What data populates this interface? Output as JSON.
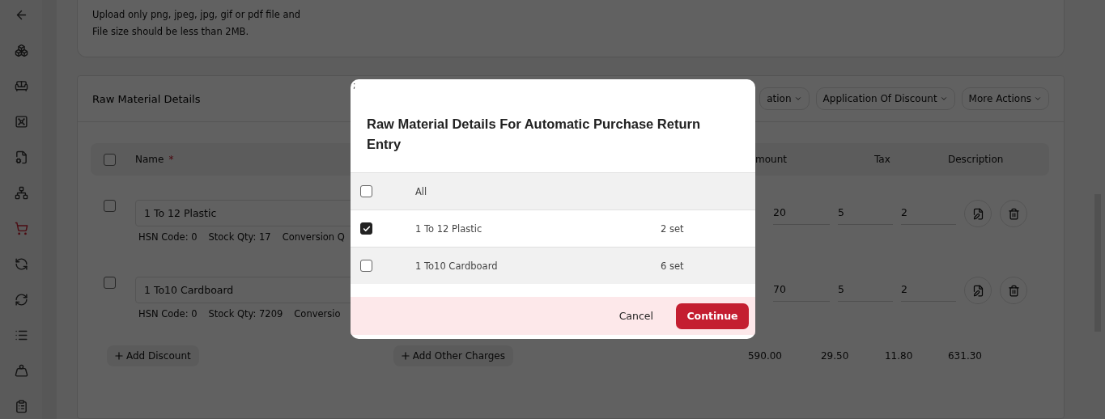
{
  "sidebar": {
    "items": [
      {
        "kind": "back",
        "selected": false
      },
      {
        "kind": "boxes",
        "selected": false
      },
      {
        "kind": "sofa",
        "selected": false
      },
      {
        "kind": "safe",
        "selected": false
      },
      {
        "kind": "file-settings",
        "selected": false
      },
      {
        "kind": "network",
        "selected": false
      },
      {
        "kind": "cart",
        "selected": true
      },
      {
        "kind": "cart-cycle",
        "selected": false
      },
      {
        "kind": "cycle",
        "selected": false
      },
      {
        "kind": "list",
        "selected": false
      },
      {
        "kind": "weight",
        "selected": false
      },
      {
        "kind": "clipboard",
        "selected": false
      }
    ]
  },
  "upload_note": {
    "lines": [
      "Upload only png, jpeg, jpg, gif or pdf file and",
      "File size should be less than 2MB."
    ]
  },
  "raw_materials": {
    "title": "Raw Material Details",
    "actions": [
      "ation",
      "Application Of Discount",
      "More Actions"
    ],
    "columns": {
      "name": "Name",
      "required_mark": "*",
      "column_2": "mount",
      "tax": "Tax",
      "description": "Description"
    },
    "header_checked": false,
    "rows": [
      {
        "checked": false,
        "name": "1 To 12 Plastic",
        "meta": [
          "HSN Code: 0",
          "Stock Qty: 17",
          "Conversion Q"
        ],
        "values": [
          "20",
          "5",
          "2"
        ]
      },
      {
        "checked": false,
        "name": "1 To10 Cardboard",
        "meta": [
          "HSN Code: 0",
          "Stock Qty: 7209",
          "Conversio"
        ],
        "values": [
          "70",
          "5",
          "2"
        ]
      }
    ],
    "add_discount": "Add Discount",
    "add_other_charges": "Add Other Charges",
    "totals": [
      "590.00",
      "29.50",
      "11.80",
      "631.30"
    ]
  },
  "modal": {
    "mark": ";",
    "title": "Raw Material Details For Automatic Purchase Return Entry",
    "all": {
      "label": "All",
      "checked": false
    },
    "items": [
      {
        "name": "1 To 12 Plastic",
        "quantity": "2 set",
        "checked": true
      },
      {
        "name": "1 To10 Cardboard",
        "quantity": "6 set",
        "checked": false
      }
    ],
    "cancel": "Cancel",
    "continue": "Continue"
  }
}
